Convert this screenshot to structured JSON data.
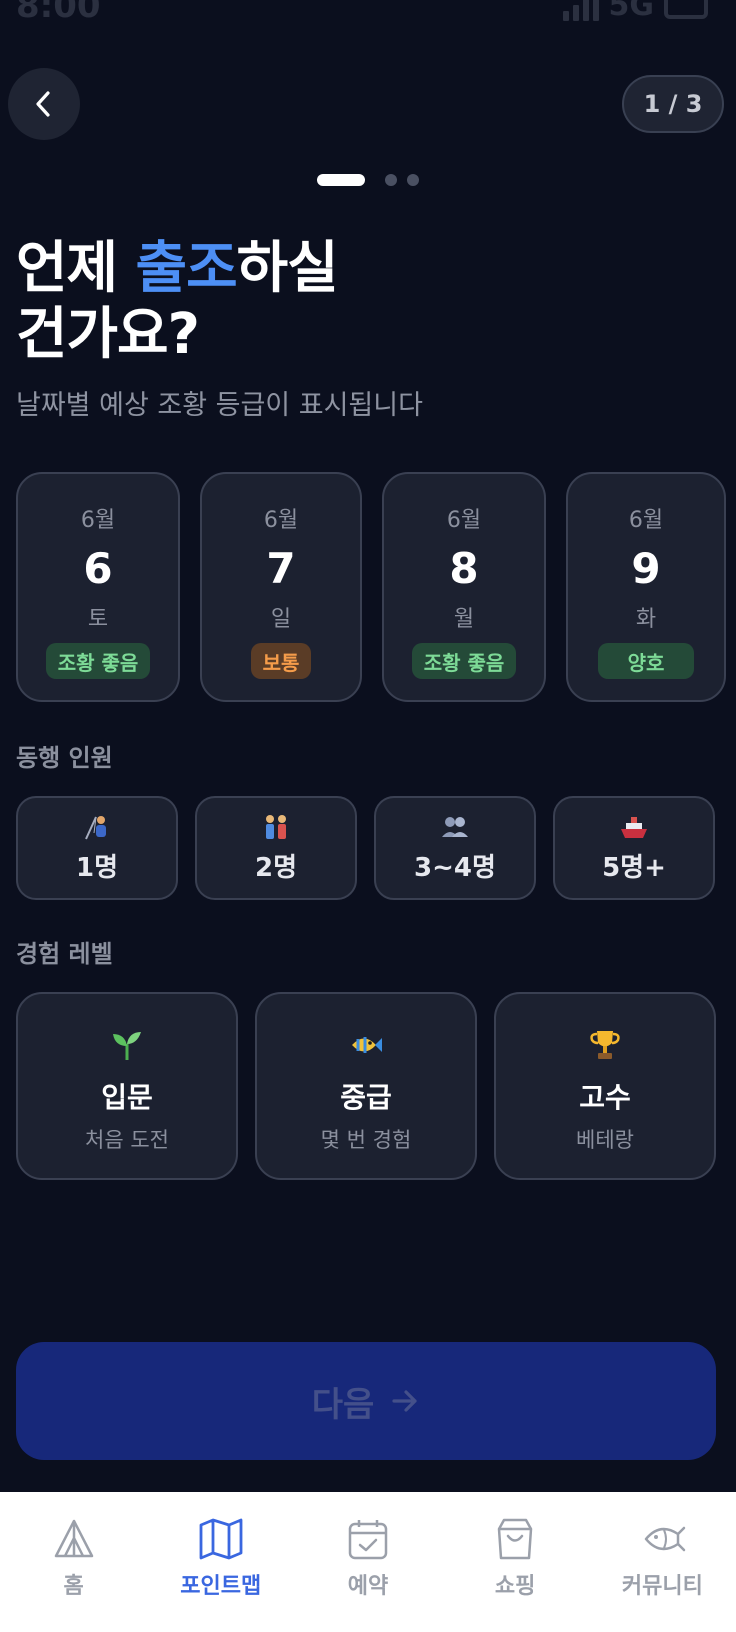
{
  "status": {
    "time": "8:00",
    "network": "5G"
  },
  "header": {
    "page_counter": "1 / 3"
  },
  "headline": {
    "line1_pre": "언제 ",
    "line1_accent": "출조",
    "line1_post": "하실",
    "line2": "건가요?",
    "subtitle": "날짜별 예상 조황 등급이 표시됩니다"
  },
  "dates": [
    {
      "month": "6월",
      "day": "6",
      "weekday": "토",
      "badge": "조황 좋음",
      "badge_color": "#7ddb97"
    },
    {
      "month": "6월",
      "day": "7",
      "weekday": "일",
      "badge": "보통",
      "badge_color": "#f59c4a"
    },
    {
      "month": "6월",
      "day": "8",
      "weekday": "월",
      "badge": "조황 좋음",
      "badge_color": "#7ddb97"
    },
    {
      "month": "6월",
      "day": "9",
      "weekday": "화",
      "badge": "양호",
      "badge_color": "#7ddb97"
    }
  ],
  "companions": {
    "label": "동행 인원",
    "options": [
      {
        "icon": "fishing-person-icon",
        "label": "1명"
      },
      {
        "icon": "couple-icon",
        "label": "2명"
      },
      {
        "icon": "group-icon",
        "label": "3~4명"
      },
      {
        "icon": "ship-icon",
        "label": "5명+"
      }
    ]
  },
  "experience": {
    "label": "경험 레벨",
    "options": [
      {
        "icon": "sprout-icon",
        "title": "입문",
        "desc": "처음 도전"
      },
      {
        "icon": "fish-icon",
        "title": "중급",
        "desc": "몇 번 경험"
      },
      {
        "icon": "trophy-icon",
        "title": "고수",
        "desc": "베테랑"
      }
    ]
  },
  "next_button": {
    "label": "다음"
  },
  "nav": {
    "items": [
      {
        "icon": "tent-icon",
        "label": "홈"
      },
      {
        "icon": "map-icon",
        "label": "포인트맵"
      },
      {
        "icon": "calendar-icon",
        "label": "예약"
      },
      {
        "icon": "shopping-bag-icon",
        "label": "쇼핑"
      },
      {
        "icon": "fish-outline-icon",
        "label": "커뮤니티"
      }
    ],
    "active_index": 1,
    "active_color": "#3a67e0"
  },
  "colors": {
    "background": "#0b0f1e",
    "accent": "#4d8ff5",
    "card": "#1c2130",
    "button": "#17287a"
  }
}
